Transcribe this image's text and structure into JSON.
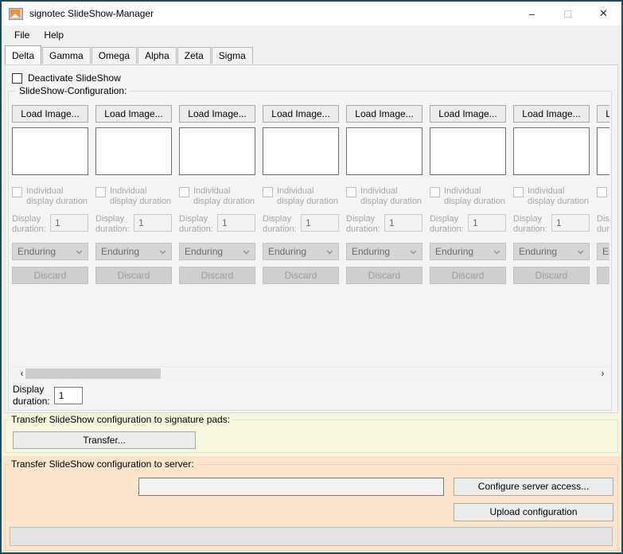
{
  "window": {
    "title": "signotec SlideShow-Manager",
    "controls": {
      "minimize_glyph": "–",
      "close_glyph": "✕"
    },
    "icon": "picture-stack-icon"
  },
  "menu": {
    "file": "File",
    "help": "Help"
  },
  "tabs": [
    {
      "label": "Delta",
      "active": true
    },
    {
      "label": "Gamma",
      "active": false
    },
    {
      "label": "Omega",
      "active": false
    },
    {
      "label": "Alpha",
      "active": false
    },
    {
      "label": "Zeta",
      "active": false
    },
    {
      "label": "Sigma",
      "active": false
    }
  ],
  "deactivate_checkbox": {
    "label": "Deactivate SlideShow",
    "checked": false
  },
  "config_group": {
    "title": "SlideShow-Configuration:",
    "slide_count": 8,
    "slide": {
      "load_button": "Load Image...",
      "individual_checkbox_label": "Individual display duration",
      "individual_checked": false,
      "duration_label_line1": "Display",
      "duration_label_line2": "duration:",
      "duration_value": "1",
      "mode_selected": "Enduring",
      "discard_button": "Discard"
    },
    "scrollbar": {
      "left_glyph": "‹",
      "right_glyph": "›"
    },
    "global_duration": {
      "label_line1": "Display",
      "label_line2": "duration:",
      "value": "1"
    }
  },
  "pads_section": {
    "title": "Transfer SlideShow configuration to signature pads:",
    "transfer_button": "Transfer..."
  },
  "server_section": {
    "title": "Transfer SlideShow configuration to server:",
    "server_field_value": "",
    "configure_button": "Configure server access...",
    "upload_button": "Upload configuration",
    "progress_value": ""
  },
  "colors": {
    "window_border": "#1d4c5e",
    "pads_bg": "#f7f7de",
    "server_bg": "#fbe5cd",
    "icon_accent": "#e8913a"
  }
}
